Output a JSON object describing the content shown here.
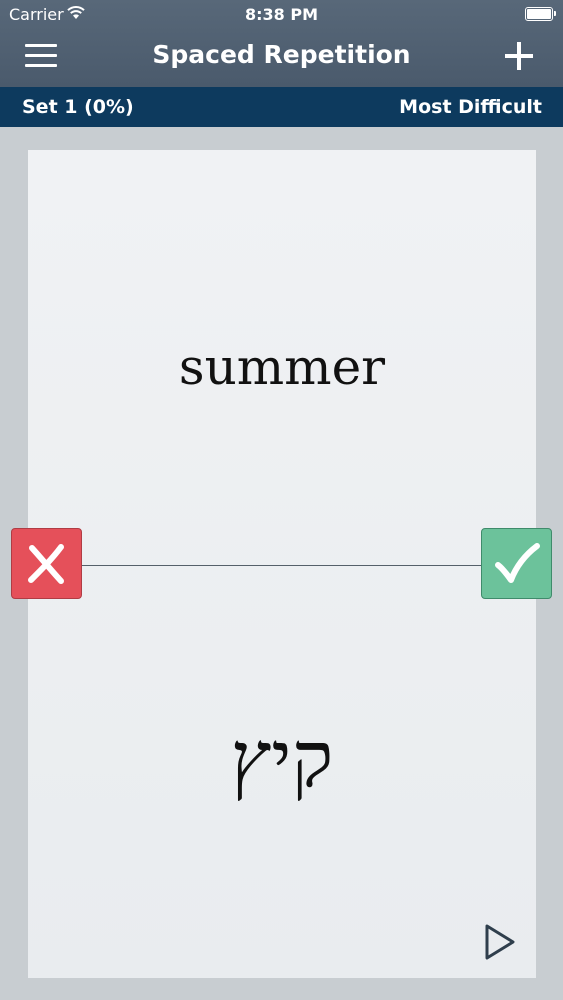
{
  "status_bar": {
    "carrier": "Carrier",
    "time": "8:38 PM",
    "wifi_icon": "wifi-icon",
    "battery_icon": "battery-icon"
  },
  "nav": {
    "title": "Spaced Repetition",
    "menu_icon": "hamburger-menu-icon",
    "add_icon": "plus-icon"
  },
  "set_bar": {
    "set_label": "Set 1 (0%)",
    "sort_label": "Most Difficult"
  },
  "card": {
    "front": "summer",
    "back": "קיץ",
    "wrong_icon": "x-mark-icon",
    "right_icon": "check-mark-icon",
    "play_icon": "play-icon"
  },
  "colors": {
    "nav_bar": "#4f5f71",
    "set_bar": "#0d3a5e",
    "wrong_button": "#e5505a",
    "right_button": "#6cc29b",
    "background": "#c8cdd1"
  }
}
